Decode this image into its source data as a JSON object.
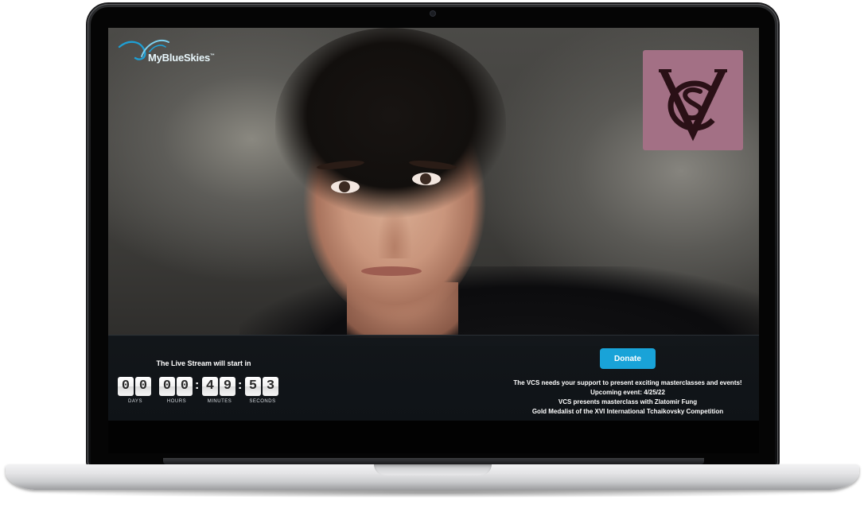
{
  "brand": {
    "name": "MyBlueSkies",
    "trademark": "™"
  },
  "badge": {
    "monogram": "VSC",
    "color": "#a37085"
  },
  "countdown": {
    "title": "The Live Stream will start in",
    "days": [
      "0",
      "0"
    ],
    "hours": [
      "0",
      "0"
    ],
    "minutes": [
      "4",
      "9"
    ],
    "seconds": [
      "5",
      "3"
    ],
    "labels": {
      "days": "DAYS",
      "hours": "HOURS",
      "minutes": "MINUTES",
      "seconds": "SECONDS"
    }
  },
  "donate": {
    "label": "Donate",
    "color": "#19a3d8"
  },
  "info": {
    "line1": "The VCS needs your support to present exciting masterclasses and events!",
    "line2": "Upcoming event: 4/25/22",
    "line3": "VCS presents masterclass with Zlatomir Fung",
    "line4": "Gold Medalist of the XVI International Tchaikovsky Competition"
  }
}
